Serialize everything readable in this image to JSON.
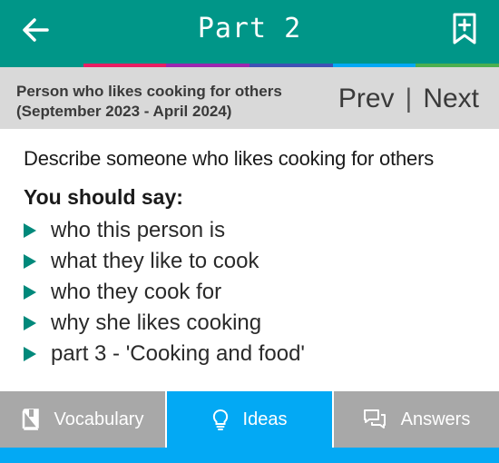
{
  "appbar": {
    "title": "Part 2",
    "back_icon": "arrow-left-icon",
    "bookmark_icon": "bookmark-add-icon",
    "color": "#009688"
  },
  "stripes": [
    "#009688",
    "#e91e63",
    "#9c27b0",
    "#3f51b5",
    "#03a9f4",
    "#4caf50"
  ],
  "topic": {
    "title_line1": "Person who likes cooking for others",
    "title_line2": "(September 2023 - April 2024)",
    "prev_label": "Prev",
    "separator": "|",
    "next_label": "Next"
  },
  "cue_card": {
    "heading": "Describe someone who likes cooking for others",
    "you_should_say": "You should say:",
    "points": [
      "who this person is",
      "what they like to cook",
      "who they cook for",
      "why she likes cooking",
      "part 3 - 'Cooking and food'"
    ],
    "bullet_color": "#00897b"
  },
  "bottom_tabs": [
    {
      "label": "Vocabulary",
      "icon": "book-icon",
      "active": false
    },
    {
      "label": "Ideas",
      "icon": "lightbulb-icon",
      "active": true
    },
    {
      "label": "Answers",
      "icon": "chat-bubbles-icon",
      "active": false
    }
  ],
  "colors": {
    "active_tab": "#03a9f4",
    "inactive_tab": "#a8a8a8",
    "topic_bg": "#d9d9d9"
  }
}
